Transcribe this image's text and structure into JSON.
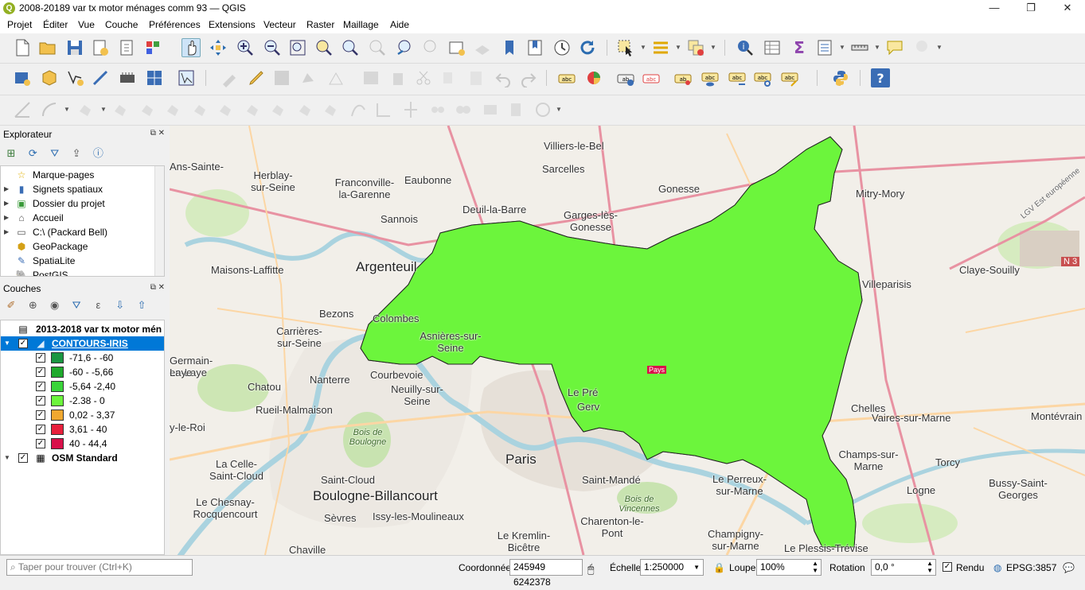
{
  "window": {
    "title": "2008-20189 var tx motor ménages comm 93 — QGIS",
    "logo": "Q",
    "buttons": {
      "minimize": "—",
      "maximize": "❐",
      "close": "✕"
    }
  },
  "menu": [
    "Projet",
    "Éditer",
    "Vue",
    "Couche",
    "Préférences",
    "Extensions",
    "Vecteur",
    "Raster",
    "Maillage",
    "Aide"
  ],
  "explorer": {
    "title": "Explorateur",
    "items": [
      {
        "label": "Marque-pages",
        "icon": "star-icon"
      },
      {
        "label": "Signets spatiaux",
        "icon": "bookmark-icon"
      },
      {
        "label": "Dossier du projet",
        "icon": "project-folder-icon"
      },
      {
        "label": "Accueil",
        "icon": "home-icon"
      },
      {
        "label": "C:\\ (Packard Bell)",
        "icon": "drive-icon"
      },
      {
        "label": "GeoPackage",
        "icon": "geopackage-icon"
      },
      {
        "label": "SpatiaLite",
        "icon": "spatialite-icon"
      },
      {
        "label": "PostGIS",
        "icon": "postgis-icon"
      }
    ]
  },
  "layers": {
    "title": "Couches",
    "group": "2013-2018 var tx motor mén",
    "layer": "CONTOURS-IRIS",
    "classes": [
      {
        "label": "-71,6 - -60",
        "color": "#1a9641"
      },
      {
        "label": "-60 - -5,66",
        "color": "#1fa92c"
      },
      {
        "label": "-5,64 -2,40",
        "color": "#3ad43a"
      },
      {
        "label": "-2.38 - 0",
        "color": "#6cf53c"
      },
      {
        "label": "0,02 - 3,37",
        "color": "#f0a830"
      },
      {
        "label": "3,61 - 40",
        "color": "#e8203c"
      },
      {
        "label": "40 - 44,4",
        "color": "#d8104a"
      }
    ],
    "basemap": "OSM Standard"
  },
  "map": {
    "labels": [
      "Villiers-le-Bel",
      "Sarcelles",
      "Herblay-sur-Seine",
      "Franconville-la-Garenne",
      "Eaubonne",
      "Gonesse",
      "Mitry-Mory",
      "Deuil-la-Barre",
      "Garges-lès-Gonesse",
      "Sannois",
      "Argenteuil",
      "Maisons-Laffitte",
      "Claye-Souilly",
      "Villeparisis",
      "Bezons",
      "Colombes",
      "Carrières-sur-Seine",
      "Asnières-sur-Seine",
      "Germain-en-Laye",
      "Nanterre",
      "Courbevoie",
      "Chatou",
      "Neuilly-sur-Seine",
      "Rueil-Malmaison",
      "Bois de Boulogne",
      "Paris",
      "Saint-Mandé",
      "Chelles",
      "Vaires-sur-Marne",
      "Montévrain",
      "La Celle-Saint-Cloud",
      "Saint-Cloud",
      "Boulogne-Billancourt",
      "Le Perreux-sur-Marne",
      "Champs-sur-Marne",
      "Torcy",
      "Le Chesnay-Rocquencourt",
      "Issy-les-Moulineaux",
      "Bois de Vincennes",
      "Logne",
      "Bussy-Saint-Georges",
      "Sèvres",
      "Charenton-le-Pont",
      "Chaville",
      "Le Kremlin-Bicêtre",
      "Champigny-sur-Marne",
      "Le Plessis-Trévise",
      "Ans-Sainte-",
      "y-le-Roi",
      "Laye",
      "Le Pré",
      "Gerv",
      "LGV Est européenne",
      "N 3",
      "Pays"
    ]
  },
  "status": {
    "search_placeholder": "Taper pour trouver (Ctrl+K)",
    "coord_label": "Coordonnée",
    "coord_value": "245949 6242378",
    "scale_label": "Échelle",
    "scale_value": "1:250000",
    "zoom_label": "Loupe",
    "zoom_value": "100%",
    "rotation_label": "Rotation",
    "rotation_value": "0,0 °",
    "render_label": "Rendu",
    "crs": "EPSG:3857"
  }
}
